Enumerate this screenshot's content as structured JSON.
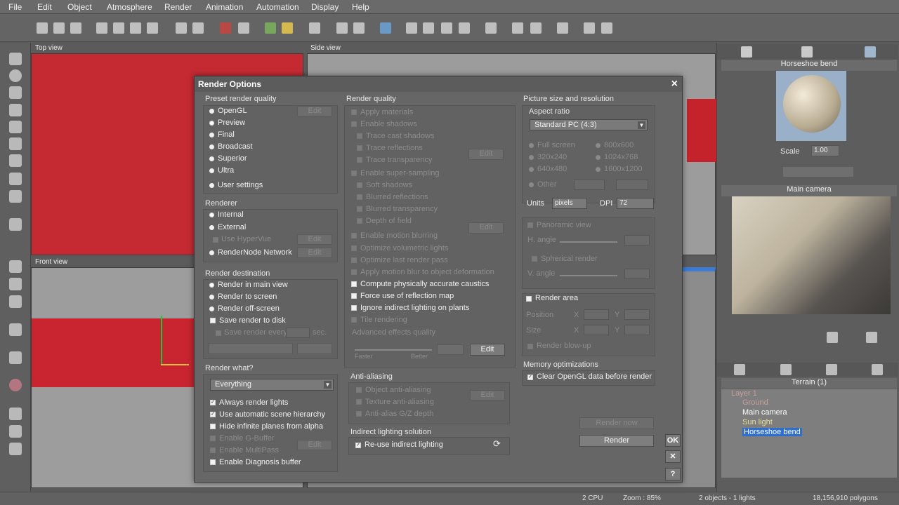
{
  "menu": [
    "File",
    "Edit",
    "Object",
    "Atmosphere",
    "Render",
    "Animation",
    "Automation",
    "Display",
    "Help"
  ],
  "viewports": {
    "top": "Top view",
    "side": "Side view",
    "front": "Front view"
  },
  "dialog": {
    "title": "Render Options",
    "close": "×",
    "preset": {
      "label": "Preset render quality",
      "items": [
        "OpenGL",
        "Preview",
        "Final",
        "Broadcast",
        "Superior",
        "Ultra",
        "User settings"
      ],
      "edit": "Edit"
    },
    "renderer": {
      "label": "Renderer",
      "items": [
        "Internal",
        "External",
        "Use HyperVue",
        "RenderNode Network"
      ],
      "edit": "Edit"
    },
    "destination": {
      "label": "Render destination",
      "items": [
        "Render in main view",
        "Render to screen",
        "Render off-screen",
        "Save render to disk"
      ],
      "save_every": "Save render every",
      "unit": "sec."
    },
    "what": {
      "label": "Render what?",
      "selected": "Everything",
      "checks": [
        "Always render lights",
        "Use automatic scene hierarchy",
        "Hide infinite planes from alpha",
        "Enable G-Buffer",
        "Enable MultiPass",
        "Enable Diagnosis buffer"
      ],
      "edit": "Edit"
    },
    "quality": {
      "label": "Render quality",
      "items": [
        "Apply materials",
        "Enable shadows",
        "Trace cast shadows",
        "Trace reflections",
        "Trace transparency",
        "Enable super-sampling",
        "Soft shadows",
        "Blurred reflections",
        "Blurred transparency",
        "Depth of field",
        "Enable motion blurring",
        "Optimize volumetric lights",
        "Optimize last render pass",
        "Apply motion blur to object deformation",
        "Compute physically accurate caustics",
        "Force use of reflection map",
        "Ignore indirect lighting on plants",
        "Tile rendering"
      ],
      "advanced": "Advanced effects quality",
      "faster": "Faster",
      "better": "Better",
      "edit": "Edit",
      "edit2": "Edit"
    },
    "antialias": {
      "label": "Anti-aliasing",
      "items": [
        "Object anti-aliasing",
        "Texture anti-aliasing",
        "Anti-alias G/Z depth"
      ],
      "edit": "Edit"
    },
    "indirect": {
      "label": "Indirect lighting solution",
      "reuse": "Re-use indirect lighting"
    },
    "picture": {
      "label": "Picture size and resolution",
      "aspect_label": "Aspect ratio",
      "aspect": "Standard PC (4:3)",
      "sizes": [
        "Full screen",
        "800x600",
        "320x240",
        "1024x768",
        "640x480",
        "1600x1200"
      ],
      "other": "Other",
      "units_label": "Units",
      "units": "pixels",
      "dpi_label": "DPI",
      "dpi": "72",
      "panoramic": "Panoramic view",
      "h_angle": "H. angle",
      "spherical": "Spherical render",
      "v_angle": "V. angle"
    },
    "area": {
      "label": "Render area",
      "position": "Position",
      "size": "Size",
      "blowup": "Render blow-up",
      "x": "X",
      "y": "Y"
    },
    "memory": {
      "label": "Memory optimizations",
      "clear": "Clear OpenGL data before render"
    },
    "buttons": {
      "render_now": "Render now",
      "render": "Render",
      "ok": "OK",
      "cancel": "✕",
      "help": "?"
    }
  },
  "right": {
    "material_title": "Horseshoe bend",
    "scale_label": "Scale",
    "scale": "1.00",
    "camera_title": "Main camera",
    "tree_title": "Terrain (1)",
    "tree": [
      "Layer 1",
      "Ground",
      "Main camera",
      "Sun light",
      "Horseshoe bend"
    ]
  },
  "status": {
    "cpu": "2 CPU",
    "zoom": "Zoom : 85%",
    "objects": "2 objects - 1 lights",
    "polygons": "18,156,910 polygons"
  }
}
